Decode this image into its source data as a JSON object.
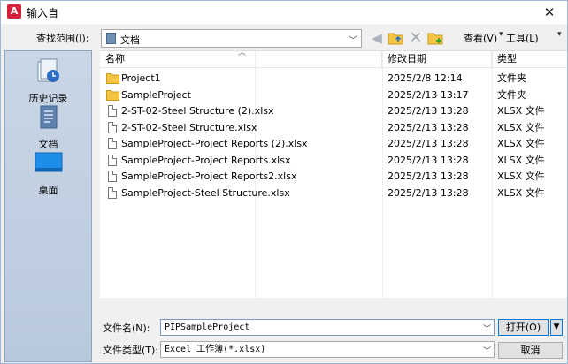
{
  "window": {
    "title": "输入自",
    "close_glyph": "✕",
    "app_icon_letter": "A"
  },
  "toolbar": {
    "lookin_label": "查找范围(I):",
    "lookin_value": "文档",
    "view_label": "查看(V)",
    "tools_label": "工具(L)"
  },
  "places": [
    {
      "label": "历史记录",
      "icon": "history-icon"
    },
    {
      "label": "文档",
      "icon": "documents-icon"
    },
    {
      "label": "桌面",
      "icon": "desktop-icon"
    }
  ],
  "columns": {
    "name": "名称",
    "date": "修改日期",
    "type": "类型"
  },
  "files": [
    {
      "name": "Project1",
      "date": "2025/2/8 12:14",
      "type": "文件夹",
      "kind": "folder"
    },
    {
      "name": "SampleProject",
      "date": "2025/2/13 13:17",
      "type": "文件夹",
      "kind": "folder"
    },
    {
      "name": "2-ST-02-Steel Structure (2).xlsx",
      "date": "2025/2/13 13:28",
      "type": "XLSX 文件",
      "kind": "file"
    },
    {
      "name": "2-ST-02-Steel Structure.xlsx",
      "date": "2025/2/13 13:28",
      "type": "XLSX 文件",
      "kind": "file"
    },
    {
      "name": "SampleProject-Project Reports (2).xlsx",
      "date": "2025/2/13 13:28",
      "type": "XLSX 文件",
      "kind": "file"
    },
    {
      "name": "SampleProject-Project Reports.xlsx",
      "date": "2025/2/13 13:28",
      "type": "XLSX 文件",
      "kind": "file"
    },
    {
      "name": "SampleProject-Project Reports2.xlsx",
      "date": "2025/2/13 13:28",
      "type": "XLSX 文件",
      "kind": "file"
    },
    {
      "name": "SampleProject-Steel Structure.xlsx",
      "date": "2025/2/13 13:28",
      "type": "XLSX 文件",
      "kind": "file"
    }
  ],
  "bottom": {
    "filename_label": "文件名(N):",
    "filename_value": "PIPSampleProject",
    "filetype_label": "文件类型(T):",
    "filetype_value": "Excel 工作簿(*.xlsx)",
    "open_label": "打开(O)",
    "cancel_label": "取消"
  },
  "colors": {
    "folder": "#f4c542",
    "places_bg": "#c9d6e6",
    "accent": "#0078d7"
  }
}
